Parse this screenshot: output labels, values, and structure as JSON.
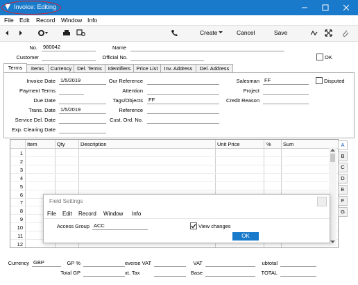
{
  "window": {
    "title": "Invoice: Editing"
  },
  "menubar": [
    "File",
    "Edit",
    "Record",
    "Window",
    "Info"
  ],
  "toolbar": {
    "create": "Create",
    "cancel": "Cancel",
    "save": "Save"
  },
  "header": {
    "no_label": "No.",
    "no_value": "980042",
    "name_label": "Name",
    "name_value": "",
    "customer_label": "Customer",
    "customer_value": "",
    "official_no_label": "Official No.",
    "official_no_value": "",
    "ok_label": "OK"
  },
  "tabs": [
    "Terms",
    "Items",
    "Currency",
    "Del. Terms",
    "Identifiers",
    "Price List",
    "Inv. Address",
    "Del. Address"
  ],
  "terms": {
    "invoice_date_label": "Invoice Date",
    "invoice_date": "1/5/2019",
    "payment_terms_label": "Payment Terms",
    "payment_terms": "",
    "due_date_label": "Due Date",
    "due_date": "",
    "trans_date_label": "Trans. Date",
    "trans_date": "1/5/2019",
    "service_del_date_label": "Service Del. Date",
    "service_del_date": "",
    "exp_clearing_date_label": "Exp. Clearing Date",
    "exp_clearing_date": "",
    "our_reference_label": "Our Reference",
    "our_reference": "",
    "attention_label": "Attention",
    "attention": "",
    "tags_label": "Tags/Objects",
    "tags": "FF",
    "reference_label": "Reference",
    "reference": "",
    "cust_ord_no_label": "Cust. Ord. No.",
    "cust_ord_no": "",
    "salesman_label": "Salesman",
    "salesman": "FF",
    "project_label": "Project",
    "project": "",
    "credit_reason_label": "Credit Reason",
    "credit_reason": "",
    "disputed_label": "Disputed"
  },
  "grid": {
    "columns": [
      "Item",
      "Qty",
      "Description",
      "Unit Price",
      "%",
      "Sum"
    ],
    "rows": [
      "1",
      "2",
      "3",
      "4",
      "5",
      "6",
      "7",
      "8",
      "9",
      "10",
      "11",
      "12"
    ],
    "side_tabs": [
      "A",
      "B",
      "C",
      "D",
      "E",
      "F",
      "G"
    ]
  },
  "dialog": {
    "title": "Field Settings",
    "menu": [
      "File",
      "Edit",
      "Record",
      "Window",
      "Info"
    ],
    "access_group_label": "Access Group",
    "access_group_value": "ACC",
    "view_changes_label": "View changes",
    "ok_label": "OK"
  },
  "footer": {
    "currency_label": "Currency",
    "currency_value": "GBP",
    "gp_pct_label": "GP %",
    "reverse_vat_label": "everse VAT",
    "vat_label": "VAT",
    "subtotal_label": "ubtotal",
    "total_gp_label": "Total GP",
    "ext_tax_label": "xt. Tax",
    "base_label": "Base",
    "total_label": "TOTAL"
  },
  "colors": {
    "accent": "#1979ca",
    "title_highlight": "#e0202a"
  }
}
